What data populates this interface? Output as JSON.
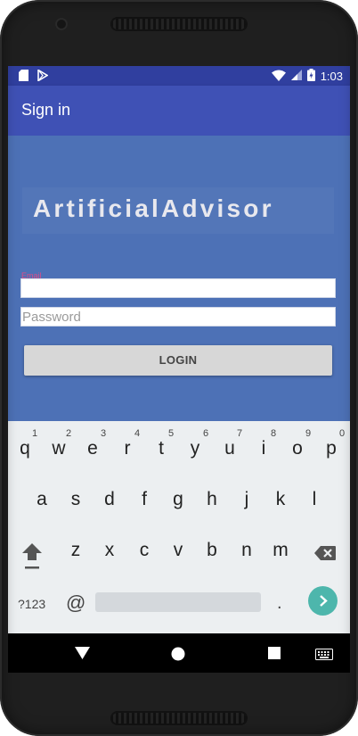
{
  "status_bar": {
    "time": "1:03",
    "left_icons": [
      "sd-card-icon",
      "play-store-icon"
    ],
    "right_icons": [
      "wifi-icon",
      "cell-signal-icon",
      "battery-icon"
    ]
  },
  "app_bar": {
    "title": "Sign in"
  },
  "logo": {
    "text": "ArtificialAdvisor"
  },
  "form": {
    "email_label": "Email",
    "email_value": "",
    "password_placeholder": "Password",
    "login_label": "LOGIN"
  },
  "keyboard": {
    "row1": [
      {
        "key": "q",
        "num": "1"
      },
      {
        "key": "w",
        "num": "2"
      },
      {
        "key": "e",
        "num": "3"
      },
      {
        "key": "r",
        "num": "4"
      },
      {
        "key": "t",
        "num": "5"
      },
      {
        "key": "y",
        "num": "6"
      },
      {
        "key": "u",
        "num": "7"
      },
      {
        "key": "i",
        "num": "8"
      },
      {
        "key": "o",
        "num": "9"
      },
      {
        "key": "p",
        "num": "0"
      }
    ],
    "row2": [
      "a",
      "s",
      "d",
      "f",
      "g",
      "h",
      "j",
      "k",
      "l"
    ],
    "row3": [
      "z",
      "x",
      "c",
      "v",
      "b",
      "n",
      "m"
    ],
    "symbols_label": "?123",
    "at_label": "@",
    "period_label": ".",
    "icons": [
      "shift-icon",
      "backspace-icon",
      "go-arrow-icon"
    ]
  },
  "nav_bar": {
    "icons": [
      "back-icon",
      "home-icon",
      "recents-icon",
      "keyboard-switch-icon"
    ]
  },
  "colors": {
    "status_bar": "#303f9f",
    "app_bar": "#3f51b5",
    "background": "#4d71b6",
    "email_label": "#e04c86",
    "go_button": "#4db6ac",
    "keyboard": "#eceff1"
  }
}
